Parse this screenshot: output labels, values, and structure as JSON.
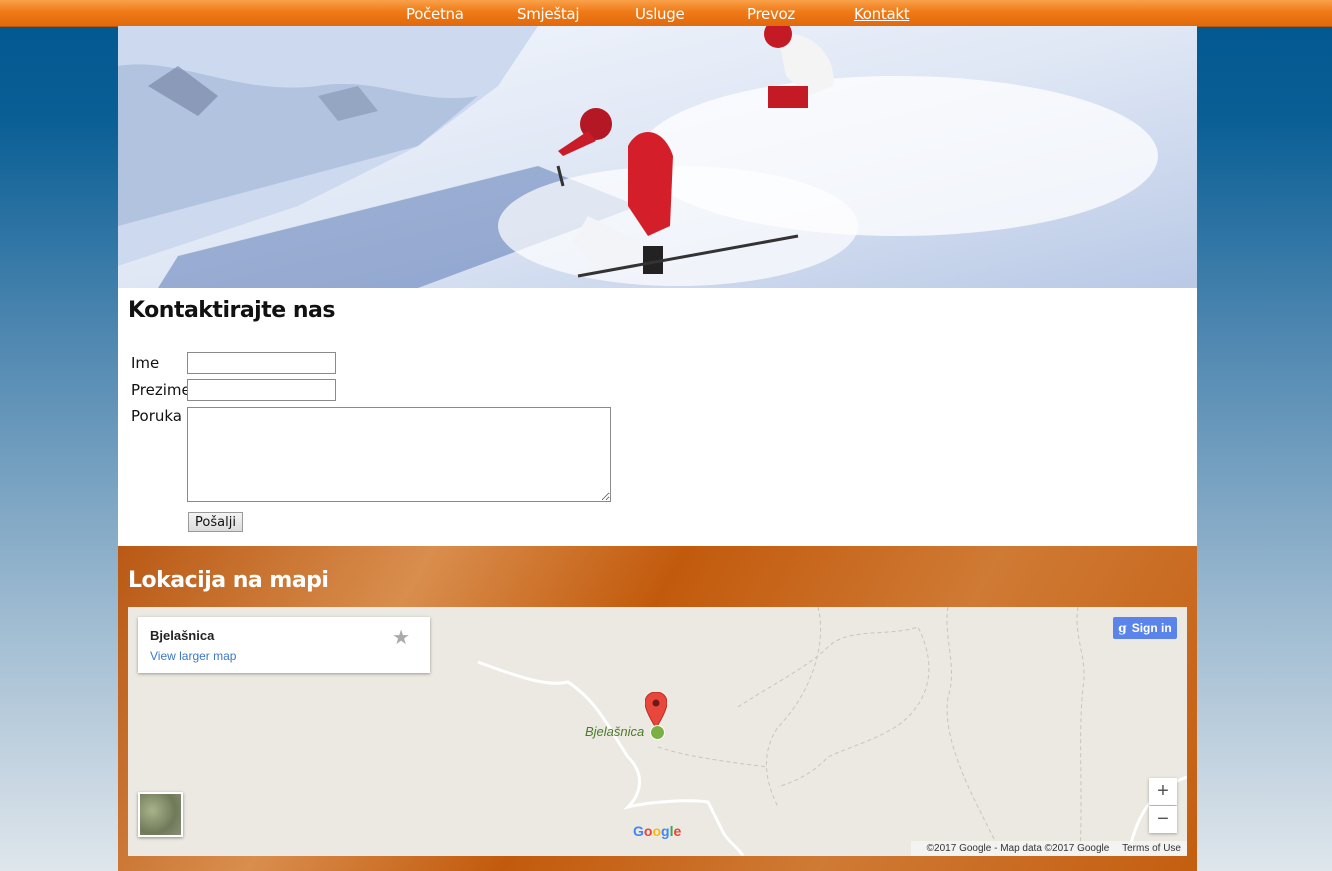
{
  "nav": {
    "items": [
      {
        "label": "Početna",
        "active": false
      },
      {
        "label": "Smještaj",
        "active": false
      },
      {
        "label": "Usluge",
        "active": false
      },
      {
        "label": "Prevoz",
        "active": false
      },
      {
        "label": "Kontakt",
        "active": true
      }
    ]
  },
  "contact": {
    "title": "Kontaktirajte nas",
    "first_name_label": "Ime",
    "last_name_label": "Prezime",
    "message_label": "Poruka",
    "first_name_value": "",
    "last_name_value": "",
    "message_value": "",
    "submit_label": "Pošalji"
  },
  "map_section": {
    "title": "Lokacija na mapi",
    "place_name": "Bjelašnica",
    "view_larger": "View larger map",
    "marker_label": "Bjelašnica",
    "sign_in": "Sign in",
    "zoom_in": "+",
    "zoom_out": "−",
    "google": "Google",
    "attribution": "©2017 Google - Map data ©2017 Google",
    "terms": "Terms of Use"
  },
  "colors": {
    "nav_orange": "#f07a17",
    "page_blue": "#00578f",
    "map_section_orange": "#c25a0c",
    "link_blue": "#3a78c8",
    "pin_red": "#e9473c"
  }
}
